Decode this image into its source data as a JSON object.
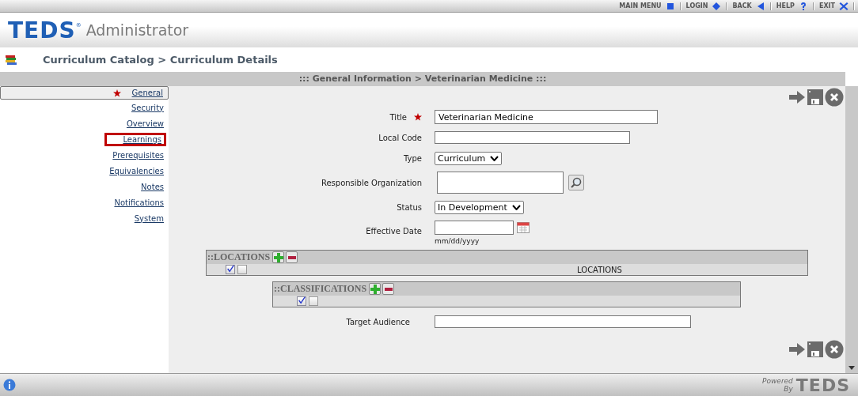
{
  "top_menu": [
    {
      "label": "MAIN MENU",
      "kind": "square"
    },
    {
      "label": "LOGIN",
      "kind": "diamond"
    },
    {
      "label": "BACK",
      "kind": "back"
    },
    {
      "label": "HELP",
      "kind": "help"
    },
    {
      "label": "EXIT",
      "kind": "exit"
    }
  ],
  "logo": {
    "brand": "TEDS",
    "reg": "®",
    "product": "Administrator"
  },
  "breadcrumb": "Curriculum Catalog > Curriculum Details",
  "section_title": "::: General Information > Veterinarian Medicine :::",
  "sidebar": {
    "items": [
      {
        "label": "General",
        "selected": true,
        "required": true,
        "highlighted": false
      },
      {
        "label": "Security",
        "selected": false,
        "required": false,
        "highlighted": false
      },
      {
        "label": "Overview",
        "selected": false,
        "required": false,
        "highlighted": false
      },
      {
        "label": "Learnings",
        "selected": false,
        "required": false,
        "highlighted": true
      },
      {
        "label": "Prerequisites",
        "selected": false,
        "required": false,
        "highlighted": false
      },
      {
        "label": "Equivalencies",
        "selected": false,
        "required": false,
        "highlighted": false
      },
      {
        "label": "Notes",
        "selected": false,
        "required": false,
        "highlighted": false
      },
      {
        "label": "Notifications",
        "selected": false,
        "required": false,
        "highlighted": false
      },
      {
        "label": "System",
        "selected": false,
        "required": false,
        "highlighted": false
      }
    ]
  },
  "fields": [
    {
      "kind": "text",
      "label": "Title",
      "required": true,
      "value": "Veterinarian Medicine"
    },
    {
      "kind": "text",
      "label": "Local Code",
      "required": false
    },
    {
      "kind": "select",
      "label": "Type",
      "required": false,
      "value": "Curriculum"
    },
    {
      "kind": "lookup",
      "label": "Responsible Organization",
      "required": false
    },
    {
      "kind": "select",
      "label": "Status",
      "required": false,
      "value": "In Development"
    },
    {
      "kind": "date",
      "label": "Effective Date",
      "required": false,
      "hint": "mm/dd/yyyy"
    }
  ],
  "locations": {
    "title": "::LOCATIONS",
    "column": "LOCATIONS",
    "check_all": true,
    "check_row": false
  },
  "classifications": {
    "title": "::CLASSIFICATIONS",
    "check_all": true,
    "check_row": false
  },
  "target_audience": {
    "label": "Target Audience"
  },
  "footer": {
    "powered": "Powered",
    "by": "By",
    "brand": "TEDS"
  }
}
